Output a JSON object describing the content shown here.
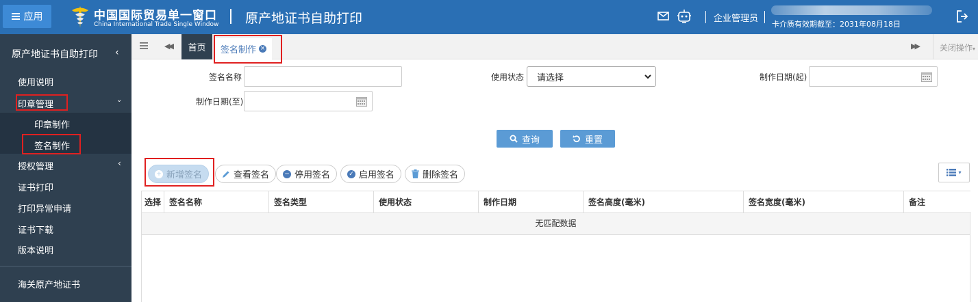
{
  "topbar": {
    "app_button_label": "应用",
    "logo_cn": "中国国际贸易单一窗口",
    "logo_en": "China International Trade Single Window",
    "system_title": "原产地证书自助打印",
    "user_role": "企业管理员",
    "card_expiry": "卡介质有效期截至：2031年08月18日",
    "brand_color": "#2a6fb4"
  },
  "sidebar": {
    "header": "原产地证书自助打印",
    "items": [
      {
        "label": "使用说明"
      },
      {
        "label": "印章管理"
      },
      {
        "label": "印章制作"
      },
      {
        "label": "签名制作"
      },
      {
        "label": "授权管理"
      },
      {
        "label": "证书打印"
      },
      {
        "label": "打印异常申请"
      },
      {
        "label": "证书下载"
      },
      {
        "label": "版本说明"
      }
    ],
    "footer": "海关原产地证书"
  },
  "tabs": {
    "home": "首页",
    "active": "签名制作",
    "close_ops": "关闭操作"
  },
  "filters": {
    "name_label": "签名名称",
    "status_label": "使用状态",
    "status_value": "请选择",
    "date_from_label": "制作日期(起)",
    "date_to_label": "制作日期(至)"
  },
  "buttons": {
    "search": "查询",
    "reset": "重置"
  },
  "actions": {
    "add": "新增签名",
    "view": "查看签名",
    "disable": "停用签名",
    "enable": "启用签名",
    "delete": "删除签名"
  },
  "table": {
    "columns": [
      "选择",
      "签名名称",
      "签名类型",
      "使用状态",
      "制作日期",
      "签名高度(毫米)",
      "签名宽度(毫米)",
      "备注"
    ],
    "empty_text": "无匹配数据"
  }
}
